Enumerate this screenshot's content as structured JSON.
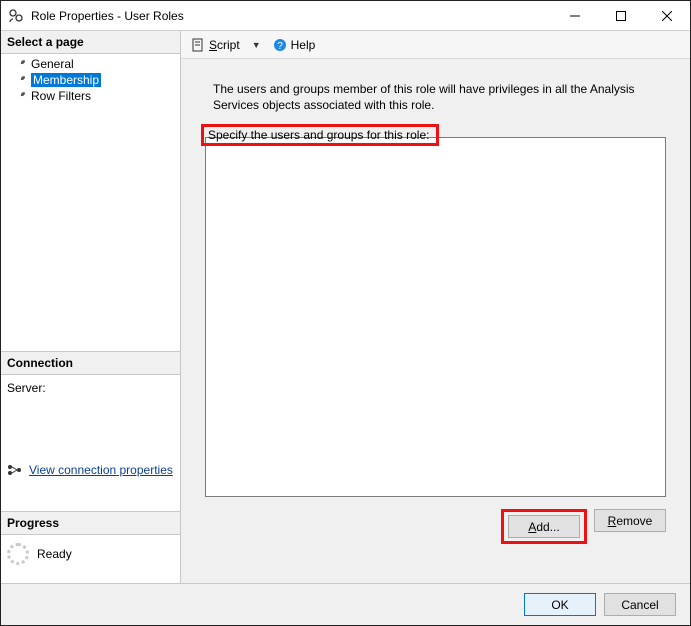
{
  "window": {
    "title": "Role Properties - User Roles"
  },
  "sidebar": {
    "select_page_header": "Select a page",
    "pages": [
      {
        "label": "General",
        "selected": false
      },
      {
        "label": "Membership",
        "selected": true
      },
      {
        "label": "Row Filters",
        "selected": false
      }
    ],
    "connection_header": "Connection",
    "server_label": "Server:",
    "server_value": "",
    "view_connection_link": "View connection properties",
    "progress_header": "Progress",
    "progress_status": "Ready"
  },
  "toolbar": {
    "script_label": "Script",
    "help_label": "Help"
  },
  "main": {
    "description": "The users and groups member of this role will have privileges in all the Analysis Services objects associated with this role.",
    "specify_label": "Specify the users and groups for this role:",
    "add_label": "Add...",
    "remove_label": "Remove"
  },
  "footer": {
    "ok_label": "OK",
    "cancel_label": "Cancel"
  }
}
